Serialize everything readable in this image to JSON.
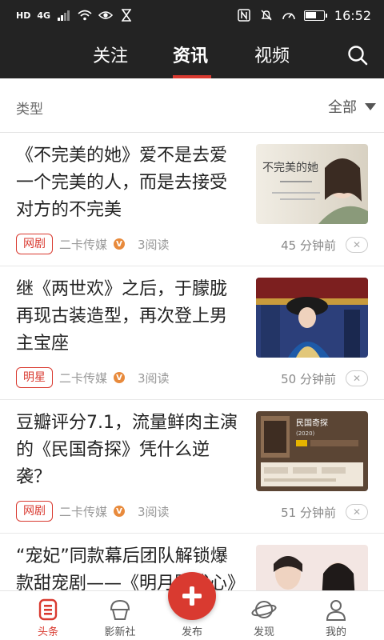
{
  "status_bar": {
    "time": "16:52",
    "network": "4G",
    "hd": "HD",
    "battery_level": 0.6
  },
  "top_nav": {
    "tabs": [
      {
        "label": "关注"
      },
      {
        "label": "资讯",
        "active": true
      },
      {
        "label": "视频"
      }
    ]
  },
  "filter": {
    "label": "类型",
    "selected": "全部"
  },
  "articles": [
    {
      "title": "《不完美的她》爱不是去爱一个完美的人，而是去接受对方的不完美",
      "tag": "网剧",
      "source": "二卡传媒",
      "verified_mark": "V",
      "reads": "3阅读",
      "time": "45 分钟前",
      "close": "✕"
    },
    {
      "title": "继《两世欢》之后，于朦胧再现古装造型，再次登上男主宝座",
      "tag": "明星",
      "source": "二卡传媒",
      "verified_mark": "V",
      "reads": "3阅读",
      "time": "50 分钟前",
      "close": "✕"
    },
    {
      "title": "豆瓣评分7.1，流量鲜肉主演的《民国奇探》凭什么逆袭？",
      "tag": "网剧",
      "source": "二卡传媒",
      "verified_mark": "V",
      "reads": "3阅读",
      "time": "51 分钟前",
      "close": "✕"
    },
    {
      "title": "“宠妃”同款幕后团队解锁爆款甜宠剧——《明月照我心》",
      "tag": "",
      "source": "",
      "verified_mark": "",
      "reads": "",
      "time": "",
      "close": ""
    }
  ],
  "thumb_text": {
    "t1_calligraphy": "不完美的她",
    "t3_title": "民国奇探",
    "t3_year": "(2020)"
  },
  "bottom_nav": {
    "items": [
      {
        "label": "头条",
        "icon": "headline-icon",
        "active": true
      },
      {
        "label": "影新社",
        "icon": "community-icon"
      },
      {
        "label": "发布",
        "icon": "plus-icon"
      },
      {
        "label": "发现",
        "icon": "planet-icon"
      },
      {
        "label": "我的",
        "icon": "profile-icon"
      }
    ]
  },
  "colors": {
    "accent": "#d93a30",
    "header_bg": "#232323"
  }
}
